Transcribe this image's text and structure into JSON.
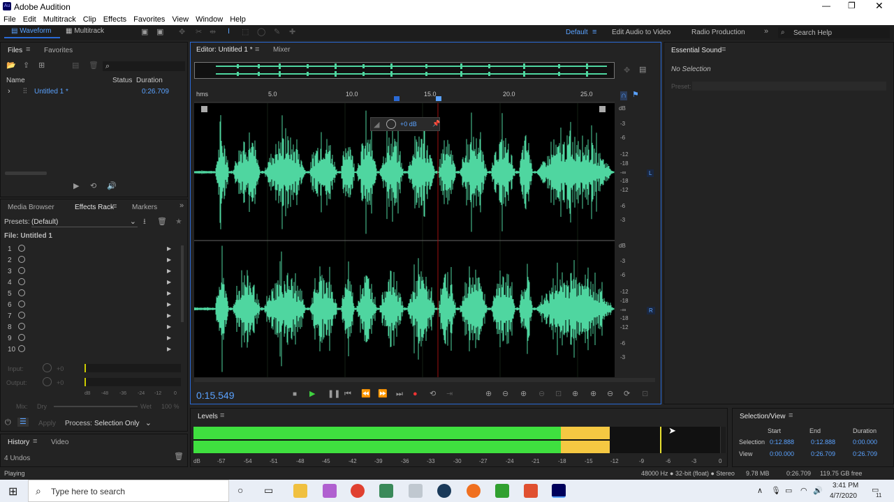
{
  "window": {
    "title": "Adobe Audition"
  },
  "menu": [
    "File",
    "Edit",
    "Multitrack",
    "Clip",
    "Effects",
    "Favorites",
    "View",
    "Window",
    "Help"
  ],
  "toolbar": {
    "waveform": "Waveform",
    "multitrack": "Multitrack",
    "workspace_default": "Default",
    "workspace_video": "Edit Audio to Video",
    "workspace_radio": "Radio Production",
    "search_placeholder": "Search Help"
  },
  "files": {
    "tab_files": "Files",
    "tab_favorites": "Favorites",
    "col_name": "Name",
    "col_status": "Status",
    "col_duration": "Duration",
    "file_name": "Untitled 1 *",
    "file_duration": "0:26.709"
  },
  "effects": {
    "tab_media": "Media Browser",
    "tab_rack": "Effects Rack",
    "tab_markers": "Markers",
    "presets_label": "Presets:",
    "presets_value": "(Default)",
    "file_label": "File: Untitled 1",
    "slots": [
      "1",
      "2",
      "3",
      "4",
      "5",
      "6",
      "7",
      "8",
      "9",
      "10"
    ],
    "input_label": "Input:",
    "input_val": "+0",
    "output_label": "Output:",
    "output_val": "+0",
    "meter_ticks": [
      "dB",
      "-48",
      "-36",
      "-24",
      "-12",
      "0"
    ],
    "mix_label": "Mix:",
    "dry": "Dry",
    "wet": "Wet",
    "mix_pct": "100 %",
    "apply": "Apply",
    "process_label": "Process:",
    "process_value": "Selection Only"
  },
  "history": {
    "tab_history": "History",
    "tab_video": "Video",
    "undos": "4 Undos"
  },
  "status": {
    "left": "Playing",
    "format": "48000 Hz ● 32-bit (float) ● Stereo",
    "size": "9.78 MB",
    "duration": "0:26.709",
    "free": "119.75 GB free"
  },
  "editor": {
    "tab": "Editor: Untitled 1 *",
    "tab_mixer": "Mixer",
    "ruler_unit": "hms",
    "ruler": [
      "5.0",
      "10.0",
      "15.0",
      "20.0",
      "25.0"
    ],
    "hud_gain": "+0 dB",
    "timecode": "0:15.549",
    "db_scale": [
      "dB",
      "-3",
      "-6",
      "-12",
      "-18",
      "-∞",
      "-18",
      "-12",
      "-6",
      "-3"
    ],
    "ch_left": "L",
    "ch_right": "R",
    "playhead_fraction": 0.58
  },
  "essential": {
    "title": "Essential Sound",
    "no_selection": "No Selection",
    "preset": "Preset:"
  },
  "levels": {
    "title": "Levels",
    "ticks": [
      "dB",
      "-57",
      "-54",
      "-51",
      "-48",
      "-45",
      "-42",
      "-39",
      "-36",
      "-33",
      "-30",
      "-27",
      "-24",
      "-21",
      "-18",
      "-15",
      "-12",
      "-9",
      "-6",
      "-3",
      "0"
    ]
  },
  "selection_view": {
    "title": "Selection/View",
    "col_start": "Start",
    "col_end": "End",
    "col_duration": "Duration",
    "row_selection": "Selection",
    "row_view": "View",
    "sel_start": "0:12.888",
    "sel_end": "0:12.888",
    "sel_duration": "0:00.000",
    "view_start": "0:00.000",
    "view_end": "0:26.709",
    "view_duration": "0:26.709"
  },
  "taskbar": {
    "search": "Type here to search",
    "time": "3:41 PM",
    "date": "4/7/2020",
    "notif": "11"
  },
  "colors": {
    "wave": "#4fd6a0",
    "accent": "#2a6ad6",
    "meter_green": "#3fe03f",
    "meter_yellow": "#f5c842"
  }
}
